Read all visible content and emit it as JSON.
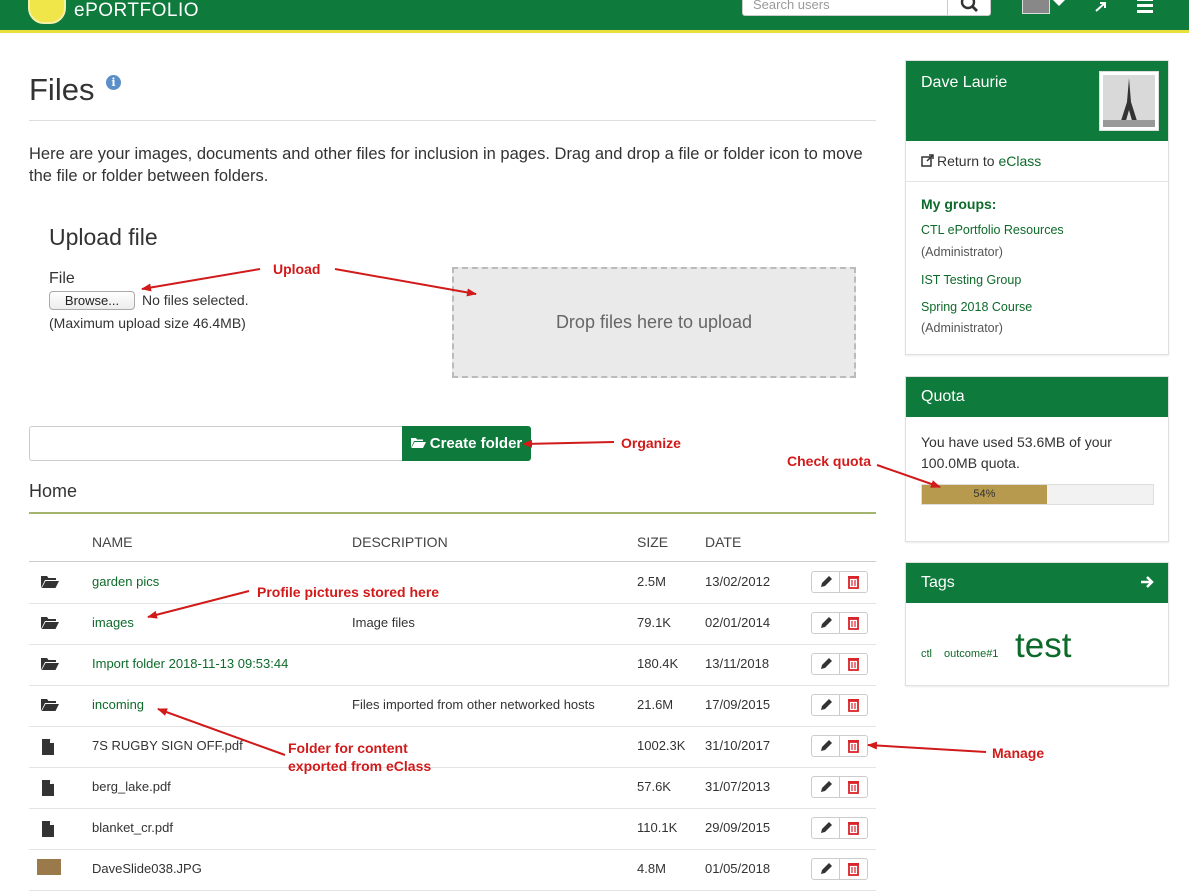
{
  "header": {
    "logo_text": "ePORTFOLIO",
    "search_placeholder": "Search users",
    "brand_color": "#0e7a3b",
    "accent_color": "#e8df3a"
  },
  "page": {
    "title": "Files",
    "intro": "Here are your images, documents and other files for inclusion in pages. Drag and drop a file or folder icon to move the file or folder between folders."
  },
  "upload": {
    "heading": "Upload file",
    "file_label": "File",
    "browse_label": "Browse...",
    "no_files": "No files selected.",
    "max_size": "(Maximum upload size 46.4MB)",
    "dropzone_text": "Drop files here to upload"
  },
  "folder": {
    "create_label": "Create folder",
    "breadcrumb": "Home"
  },
  "table": {
    "columns": [
      "NAME",
      "DESCRIPTION",
      "SIZE",
      "DATE"
    ],
    "rows": [
      {
        "type": "folder",
        "name": "garden pics",
        "description": "",
        "size": "2.5M",
        "date": "13/02/2012"
      },
      {
        "type": "folder",
        "name": "images",
        "description": "Image files",
        "size": "79.1K",
        "date": "02/01/2014"
      },
      {
        "type": "folder",
        "name": "Import folder 2018-11-13 09:53:44",
        "description": "",
        "size": "180.4K",
        "date": "13/11/2018"
      },
      {
        "type": "folder",
        "name": "incoming",
        "description": "Files imported from other networked hosts",
        "size": "21.6M",
        "date": "17/09/2015"
      },
      {
        "type": "file",
        "name": "7S RUGBY SIGN OFF.pdf",
        "description": "",
        "size": "1002.3K",
        "date": "31/10/2017"
      },
      {
        "type": "file",
        "name": "berg_lake.pdf",
        "description": "",
        "size": "57.6K",
        "date": "31/07/2013"
      },
      {
        "type": "file",
        "name": "blanket_cr.pdf",
        "description": "",
        "size": "110.1K",
        "date": "29/09/2015"
      },
      {
        "type": "image",
        "name": "DaveSlide038.JPG",
        "description": "",
        "size": "4.8M",
        "date": "01/05/2018"
      }
    ]
  },
  "sidebar": {
    "profile": {
      "name": "Dave Laurie",
      "return_prefix": "Return to ",
      "return_link": "eClass",
      "groups_title": "My groups:",
      "groups": [
        {
          "name": "CTL ePortfolio Resources",
          "role": "(Administrator)"
        },
        {
          "name": "IST Testing Group",
          "role": ""
        },
        {
          "name": "Spring 2018 Course",
          "role": "(Administrator)"
        }
      ]
    },
    "quota": {
      "title": "Quota",
      "text": "You have used 53.6MB of your 100.0MB quota.",
      "percent": 54,
      "percent_label": "54%"
    },
    "tags": {
      "title": "Tags",
      "items": [
        "ctl",
        "outcome#1",
        "test"
      ]
    }
  },
  "annotations": {
    "upload": "Upload",
    "organize": "Organize",
    "check_quota": "Check quota",
    "profile_pictures": "Profile pictures stored here",
    "folder_content_1": "Folder for content",
    "folder_content_2": "exported from eClass",
    "manage": "Manage",
    "color": "#d11a1a"
  }
}
